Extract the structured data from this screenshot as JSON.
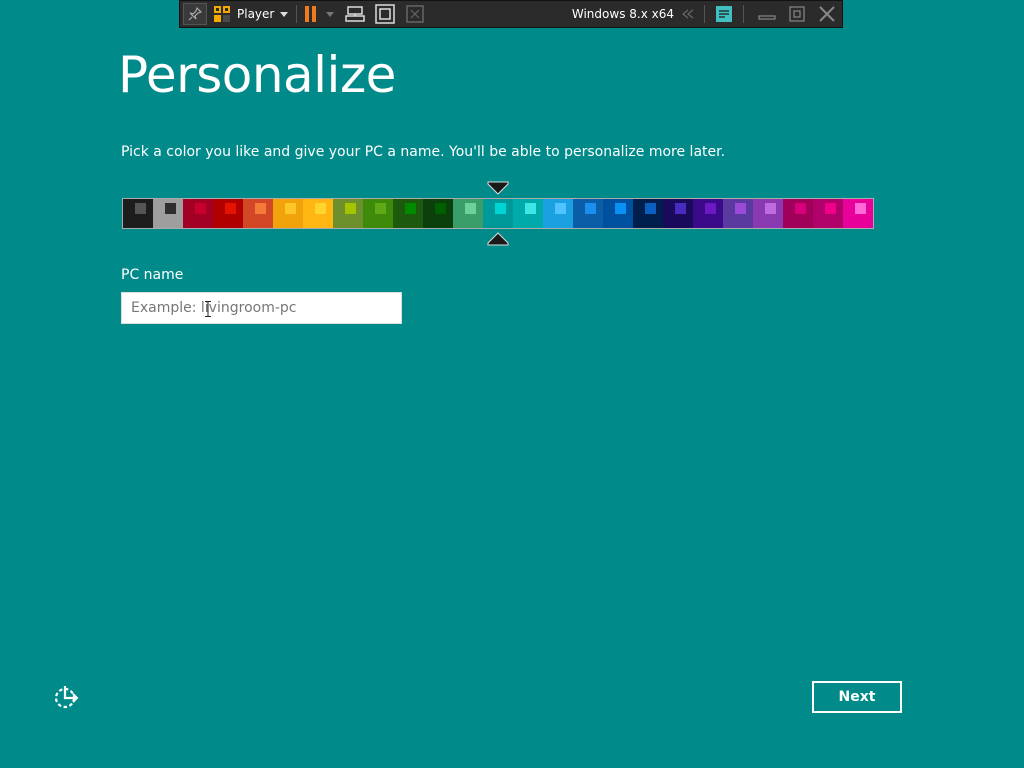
{
  "vm_toolbar": {
    "player_label": "Player",
    "vm_name": "Windows 8.x x64"
  },
  "page": {
    "title": "Personalize",
    "subtitle": "Pick a color you like and give your PC a name. You'll be able to personalize more later.",
    "pc_name_label": "PC name",
    "pc_name_value": "",
    "pc_name_placeholder": "Example: livingroom-pc",
    "next_label": "Next"
  },
  "color_picker": {
    "selected_index": 12,
    "swatches": [
      {
        "bg": "#1d1d1d",
        "chip": "#555555"
      },
      {
        "bg": "#9e9e9e",
        "chip": "#2e2e2e"
      },
      {
        "bg": "#a20025",
        "chip": "#c9002f"
      },
      {
        "bg": "#b10000",
        "chip": "#e51400"
      },
      {
        "bg": "#d24726",
        "chip": "#f47a38"
      },
      {
        "bg": "#f0a30a",
        "chip": "#ffc62a"
      },
      {
        "bg": "#ffb612",
        "chip": "#ffd42e"
      },
      {
        "bg": "#6d8f2c",
        "chip": "#a4c400"
      },
      {
        "bg": "#3e8a0a",
        "chip": "#60a917"
      },
      {
        "bg": "#1e5a0e",
        "chip": "#008a00"
      },
      {
        "bg": "#0b3f0b",
        "chip": "#006000"
      },
      {
        "bg": "#3a9e6a",
        "chip": "#6dd19b"
      },
      {
        "bg": "#009999",
        "chip": "#00d4d4"
      },
      {
        "bg": "#00aaaa",
        "chip": "#3ee6e6"
      },
      {
        "bg": "#1ba1e2",
        "chip": "#4fc3ff"
      },
      {
        "bg": "#0a5ea8",
        "chip": "#1b8ff0"
      },
      {
        "bg": "#0050a0",
        "chip": "#0a8ff5"
      },
      {
        "bg": "#001f4d",
        "chip": "#0b5fc0"
      },
      {
        "bg": "#1a0a5c",
        "chip": "#4a2bbf"
      },
      {
        "bg": "#3a0a8a",
        "chip": "#6a1ac0"
      },
      {
        "bg": "#5a3a9e",
        "chip": "#9a4ad8"
      },
      {
        "bg": "#8a3ab0",
        "chip": "#c06ae0"
      },
      {
        "bg": "#a0005a",
        "chip": "#d8007a"
      },
      {
        "bg": "#b0006a",
        "chip": "#f0008a"
      },
      {
        "bg": "#e8009a",
        "chip": "#ff6ad8"
      }
    ]
  },
  "icons": {
    "ease_of_access": "ease-of-access-icon"
  }
}
